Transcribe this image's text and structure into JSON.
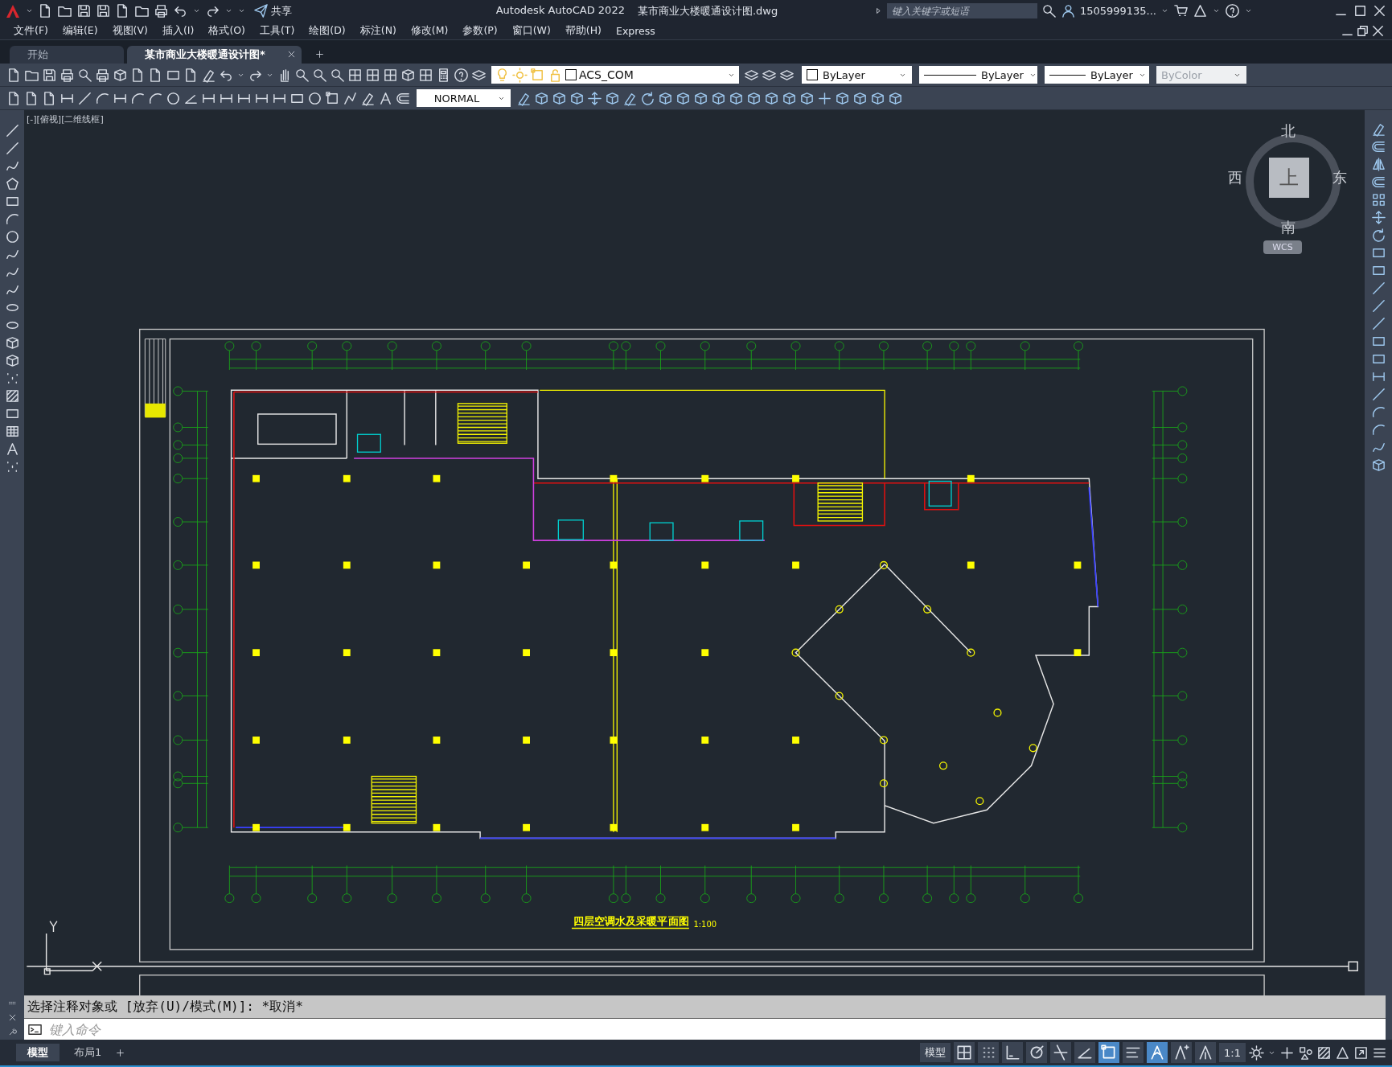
{
  "title_bar": {
    "share_label": "共享",
    "app_name": "Autodesk AutoCAD 2022",
    "file_name": "某市商业大楼暖通设计图.dwg",
    "search": {
      "placeholder": "键入关键字或短语"
    },
    "user_name": "1505999135..."
  },
  "menu": [
    "文件(F)",
    "编辑(E)",
    "视图(V)",
    "插入(I)",
    "格式(O)",
    "工具(T)",
    "绘图(D)",
    "标注(N)",
    "修改(M)",
    "参数(P)",
    "窗口(W)",
    "帮助(H)",
    "Express"
  ],
  "document_tabs": [
    {
      "label": "开始",
      "selected": false
    },
    {
      "label": "某市商业大楼暖通设计图*",
      "selected": true
    }
  ],
  "properties_toolbar": {
    "layer": "ACS_COM",
    "color_setting": "ByLayer",
    "linetype": "ByLayer",
    "lineweight": "ByLayer",
    "plot_style": {
      "value": "ByColor",
      "disabled": true
    }
  },
  "dimension_toolbar": {
    "dim_style": "NORMAL"
  },
  "viewport": {
    "label": "[-][俯视][二维线框]",
    "viewcube": {
      "north": "北",
      "south": "南",
      "east": "东",
      "west": "西",
      "face": "上",
      "ucs": "WCS"
    },
    "drawing": {
      "title": "四层空调水及采暖平面图",
      "scale": "1:100"
    }
  },
  "command_line": {
    "history": "选择注释对象或 [放弃(U)/模式(M)]: *取消*",
    "placeholder": "键入命令"
  },
  "layout_tabs": [
    {
      "label": "模型",
      "selected": true
    },
    {
      "label": "布局1",
      "selected": false
    }
  ],
  "status_bar": {
    "space": "模型",
    "annotation_scale": "1:1",
    "toggles": [
      {
        "kind": "grid",
        "on": false
      },
      {
        "kind": "dots",
        "on": false
      },
      {
        "kind": "ortho",
        "on": false
      },
      {
        "kind": "polar",
        "on": false
      },
      {
        "kind": "tracking",
        "on": false
      },
      {
        "kind": "angle",
        "on": false
      },
      {
        "kind": "selection",
        "on": true
      },
      {
        "kind": "lineweight",
        "on": false
      },
      {
        "kind": "annotation",
        "on": true
      },
      {
        "kind": "annotation-add",
        "on": false
      },
      {
        "kind": "annotation-plain",
        "on": false
      }
    ]
  }
}
